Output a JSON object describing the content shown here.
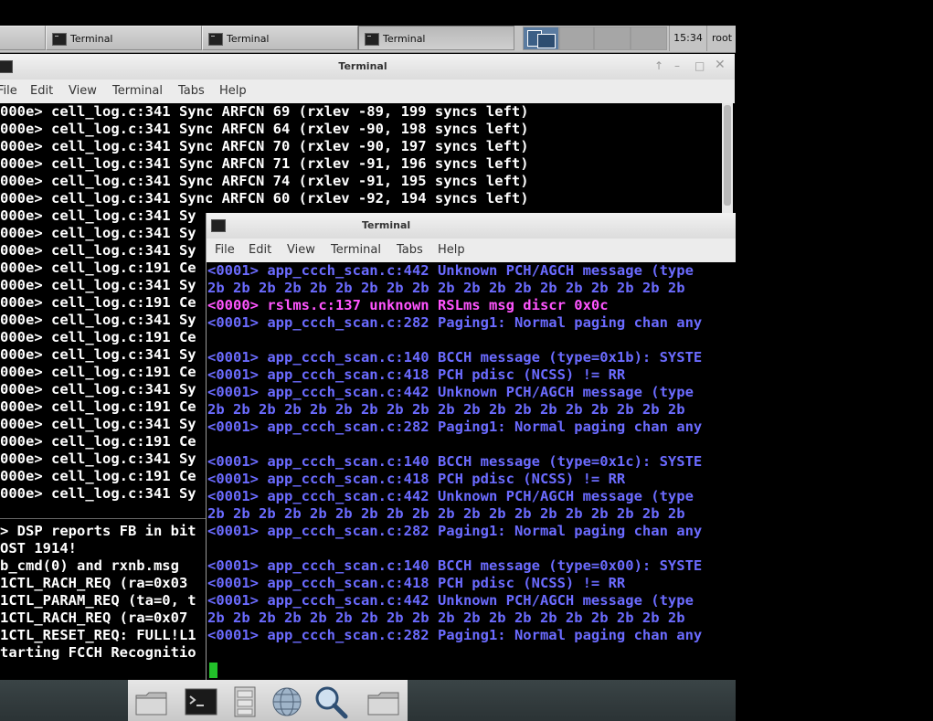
{
  "panel": {
    "tasks": [
      {
        "label": "Terminal"
      },
      {
        "label": "Terminal"
      },
      {
        "label": "Terminal"
      }
    ],
    "clock": "15:34",
    "user": "root"
  },
  "win_back": {
    "title": "Terminal",
    "menu": [
      "File",
      "Edit",
      "View",
      "Terminal",
      "Tabs",
      "Help"
    ],
    "lines_top": [
      "000e> cell_log.c:341 Sync ARFCN 69 (rxlev -89, 199 syncs left)",
      "000e> cell_log.c:341 Sync ARFCN 64 (rxlev -90, 198 syncs left)",
      "000e> cell_log.c:341 Sync ARFCN 70 (rxlev -90, 197 syncs left)",
      "000e> cell_log.c:341 Sync ARFCN 71 (rxlev -91, 196 syncs left)",
      "000e> cell_log.c:341 Sync ARFCN 74 (rxlev -91, 195 syncs left)",
      "000e> cell_log.c:341 Sync ARFCN 60 (rxlev -92, 194 syncs left)",
      "000e> cell_log.c:341 Sy",
      "000e> cell_log.c:341 Sy",
      "000e> cell_log.c:341 Sy",
      "000e> cell_log.c:191 Ce",
      "000e> cell_log.c:341 Sy",
      "000e> cell_log.c:191 Ce",
      "000e> cell_log.c:341 Sy",
      "000e> cell_log.c:191 Ce",
      "000e> cell_log.c:341 Sy",
      "000e> cell_log.c:191 Ce",
      "000e> cell_log.c:341 Sy",
      "000e> cell_log.c:191 Ce",
      "000e> cell_log.c:341 Sy",
      "000e> cell_log.c:191 Ce",
      "000e> cell_log.c:341 Sy",
      "000e> cell_log.c:191 Ce",
      "000e> cell_log.c:341 Sy"
    ],
    "lines_bottom": [
      "> DSP reports FB in bit",
      "OST 1914!",
      "b_cmd(0) and rxnb.msg",
      "1CTL_RACH_REQ (ra=0x03",
      "1CTL_PARAM_REQ (ta=0, t",
      "1CTL_RACH_REQ (ra=0x07",
      "1CTL_RESET_REQ: FULL!L1",
      "tarting FCCH Recognitio"
    ]
  },
  "win_front": {
    "title": "Terminal",
    "menu": [
      "File",
      "Edit",
      "View",
      "Terminal",
      "Tabs",
      "Help"
    ],
    "lines": [
      {
        "t": "<0001> app_ccch_scan.c:442 Unknown PCH/AGCH message (type",
        "c": "blue"
      },
      {
        "t": "2b 2b 2b 2b 2b 2b 2b 2b 2b 2b 2b 2b 2b 2b 2b 2b 2b 2b 2b",
        "c": "blue"
      },
      {
        "t": "<0000> rslms.c:137 unknown RSLms msg discr 0x0c",
        "c": "pink"
      },
      {
        "t": "<0001> app_ccch_scan.c:282 Paging1: Normal paging chan any",
        "c": "blue"
      },
      {
        "t": "",
        "c": "blue"
      },
      {
        "t": "<0001> app_ccch_scan.c:140 BCCH message (type=0x1b): SYSTE",
        "c": "blue"
      },
      {
        "t": "<0001> app_ccch_scan.c:418 PCH pdisc (NCSS) != RR",
        "c": "blue"
      },
      {
        "t": "<0001> app_ccch_scan.c:442 Unknown PCH/AGCH message (type",
        "c": "blue"
      },
      {
        "t": "2b 2b 2b 2b 2b 2b 2b 2b 2b 2b 2b 2b 2b 2b 2b 2b 2b 2b 2b",
        "c": "blue"
      },
      {
        "t": "<0001> app_ccch_scan.c:282 Paging1: Normal paging chan any",
        "c": "blue"
      },
      {
        "t": "",
        "c": "blue"
      },
      {
        "t": "<0001> app_ccch_scan.c:140 BCCH message (type=0x1c): SYSTE",
        "c": "blue"
      },
      {
        "t": "<0001> app_ccch_scan.c:418 PCH pdisc (NCSS) != RR",
        "c": "blue"
      },
      {
        "t": "<0001> app_ccch_scan.c:442 Unknown PCH/AGCH message (type",
        "c": "blue"
      },
      {
        "t": "2b 2b 2b 2b 2b 2b 2b 2b 2b 2b 2b 2b 2b 2b 2b 2b 2b 2b 2b",
        "c": "blue"
      },
      {
        "t": "<0001> app_ccch_scan.c:282 Paging1: Normal paging chan any",
        "c": "blue"
      },
      {
        "t": "",
        "c": "blue"
      },
      {
        "t": "<0001> app_ccch_scan.c:140 BCCH message (type=0x00): SYSTE",
        "c": "blue"
      },
      {
        "t": "<0001> app_ccch_scan.c:418 PCH pdisc (NCSS) != RR",
        "c": "blue"
      },
      {
        "t": "<0001> app_ccch_scan.c:442 Unknown PCH/AGCH message (type",
        "c": "blue"
      },
      {
        "t": "2b 2b 2b 2b 2b 2b 2b 2b 2b 2b 2b 2b 2b 2b 2b 2b 2b 2b 2b",
        "c": "blue"
      },
      {
        "t": "<0001> app_ccch_scan.c:282 Paging1: Normal paging chan any",
        "c": "blue"
      }
    ]
  },
  "colors": {
    "blue": "#6b6bff",
    "pink": "#ff55ff",
    "white": "#ffffff",
    "cursor": "#22c02a"
  },
  "dock": {
    "icons": [
      "folder-icon",
      "terminal-icon",
      "file-cabinet-icon",
      "network-globe-icon",
      "magnifier-icon",
      "folder-icon"
    ]
  }
}
